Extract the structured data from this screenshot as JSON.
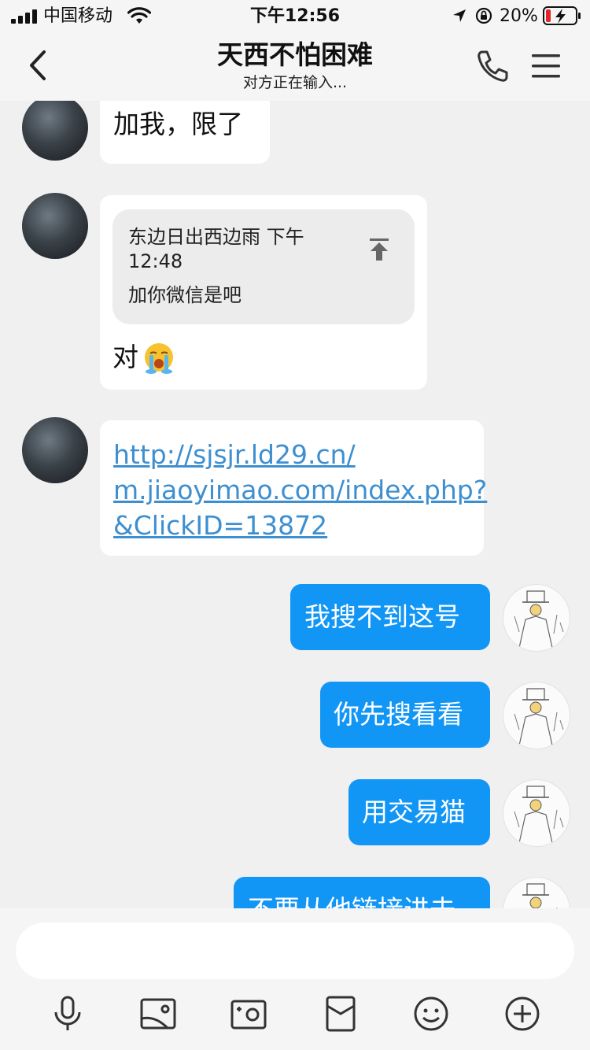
{
  "status_bar": {
    "carrier": "中国移动",
    "time": "下午12:56",
    "battery_percent": "20%"
  },
  "nav": {
    "title": "天西不怕困难",
    "subtitle": "对方正在输入..."
  },
  "messages": [
    {
      "side": "left",
      "text": "加我，限了"
    },
    {
      "side": "left",
      "quote": {
        "meta_line1": "东边日出西边雨 下午",
        "meta_line2": "12:48",
        "text": "加你微信是吧"
      },
      "text": "对"
    },
    {
      "side": "left",
      "link_lines": [
        "http://sjsjr.ld29.cn/",
        "m.jiaoyimao.com/index.php?",
        "&ClickID=13872"
      ]
    },
    {
      "side": "right",
      "text": "我搜不到这号"
    },
    {
      "side": "right",
      "text": "你先搜看看"
    },
    {
      "side": "right",
      "text": "用交易猫"
    },
    {
      "side": "right",
      "text": "不要从他链接进去"
    }
  ],
  "input": {
    "placeholder": ""
  },
  "toolbar": {
    "icons": [
      "microphone-icon",
      "photo-icon",
      "camera-icon",
      "red-packet-icon",
      "emoji-icon",
      "plus-icon"
    ]
  },
  "colors": {
    "accent_blue": "#1296f5",
    "link_blue": "#3d8fd0",
    "background": "#f0f0f0"
  }
}
